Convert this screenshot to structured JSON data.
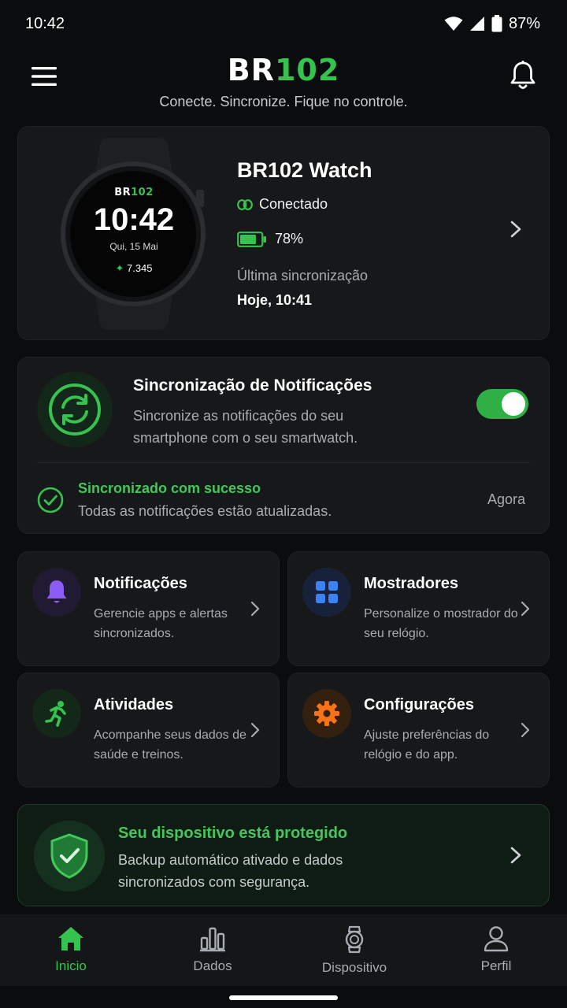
{
  "status_bar": {
    "time": "10:42",
    "battery": "87%"
  },
  "header": {
    "logo_part1": "BR",
    "logo_part2": "102",
    "tagline": "Conecte. Sincronize. Fique no controle."
  },
  "device": {
    "name": "BR102 Watch",
    "connection": "Conectado",
    "battery": "78%",
    "battery_level": 0.78,
    "last_sync_label": "Última sincronização",
    "last_sync_value": "Hoje, 10:41",
    "watch_face": {
      "brand_part1": "BR",
      "brand_part2": "102",
      "time": "10:42",
      "date": "Qui, 15 Mai",
      "steps": "7.345"
    }
  },
  "notification_sync": {
    "title": "Sincronização de Notificações",
    "description": "Sincronize as notificações do seu smartphone com o seu smartwatch.",
    "enabled": true,
    "status_title": "Sincronizado com sucesso",
    "status_desc": "Todas as notificações estão atualizadas.",
    "status_time": "Agora"
  },
  "tiles": [
    {
      "title": "Notificações",
      "desc": "Gerencie apps e alertas sincronizados.",
      "icon": "bell-icon",
      "color": "#8b5cf6"
    },
    {
      "title": "Mostradores",
      "desc": "Personalize o mostrador do seu relógio.",
      "icon": "grid-icon",
      "color": "#3b82f6"
    },
    {
      "title": "Atividades",
      "desc": "Acompanhe seus dados de saúde e treinos.",
      "icon": "running-icon",
      "color": "#36c24f"
    },
    {
      "title": "Configurações",
      "desc": "Ajuste preferências do relógio e do app.",
      "icon": "gear-icon",
      "color": "#f97316"
    }
  ],
  "protection": {
    "title": "Seu dispositivo está protegido",
    "description": "Backup automático ativado e dados sincronizados com segurança."
  },
  "bottom_nav": [
    {
      "label": "Inicio",
      "icon": "home-icon",
      "active": true
    },
    {
      "label": "Dados",
      "icon": "bar-chart-icon",
      "active": false
    },
    {
      "label": "Dispositivo",
      "icon": "watch-icon",
      "active": false
    },
    {
      "label": "Perfil",
      "icon": "person-icon",
      "active": false
    }
  ],
  "colors": {
    "accent": "#36c24f",
    "background": "#0b0c0d",
    "card": "#16181a"
  }
}
